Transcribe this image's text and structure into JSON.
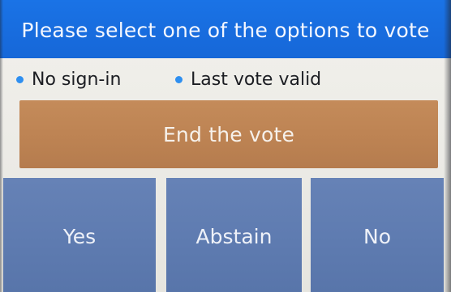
{
  "header": {
    "title": "Please select one of the options to vote"
  },
  "status": {
    "items": [
      {
        "label": "No sign-in",
        "dot_color": "#2e8ff0"
      },
      {
        "label": "Last vote valid",
        "dot_color": "#2e8ff0"
      }
    ]
  },
  "actions": {
    "end_vote_label": "End the vote"
  },
  "vote_options": [
    {
      "label": "Yes"
    },
    {
      "label": "Abstain"
    },
    {
      "label": "No"
    }
  ],
  "colors": {
    "header_bg": "#1a73e6",
    "end_button_bg": "#c0875a",
    "vote_button_bg": "#6280b4",
    "screen_bg": "#efeee9"
  }
}
